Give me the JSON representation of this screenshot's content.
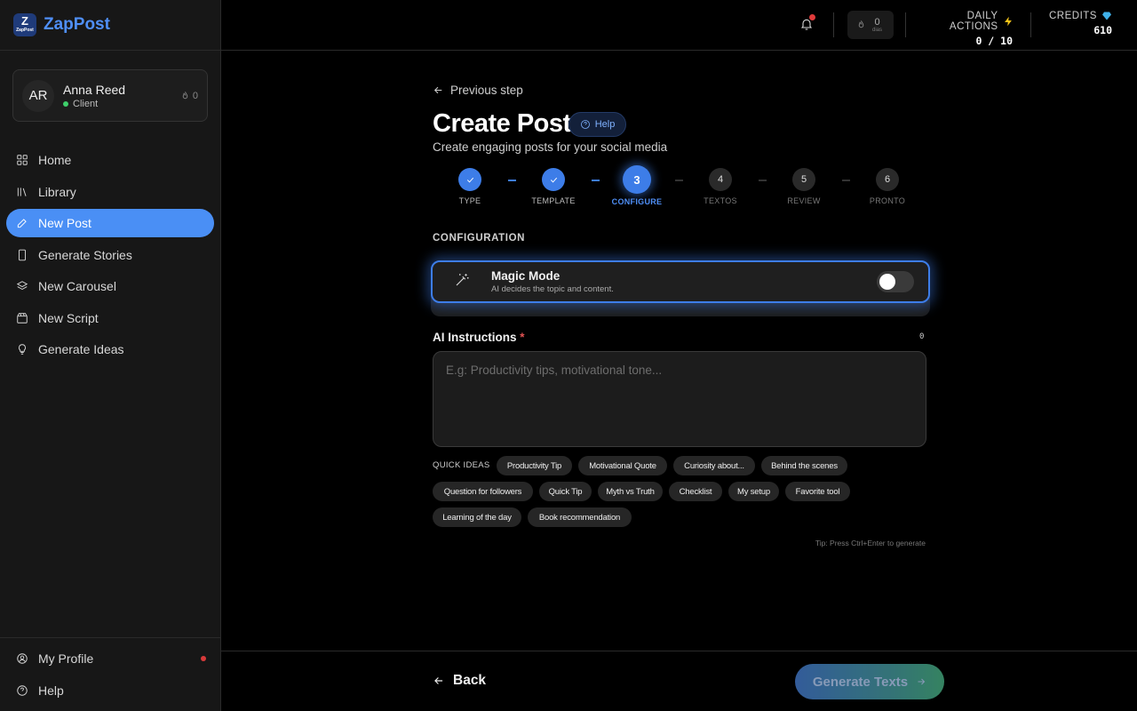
{
  "brand": {
    "logo_line1": "Z",
    "logo_line2": "ZapPost",
    "name": "ZapPost"
  },
  "user": {
    "initials": "AR",
    "name": "Anna Reed",
    "role": "Client",
    "streak": "0"
  },
  "nav": {
    "items": [
      {
        "label": "Home",
        "icon": "grid-icon"
      },
      {
        "label": "Library",
        "icon": "library-icon"
      },
      {
        "label": "New Post",
        "icon": "pen-icon",
        "active": true
      },
      {
        "label": "Generate Stories",
        "icon": "phone-icon"
      },
      {
        "label": "New Carousel",
        "icon": "layers-icon"
      },
      {
        "label": "New Script",
        "icon": "clapper-icon"
      },
      {
        "label": "Generate Ideas",
        "icon": "lightbulb-icon"
      }
    ],
    "bottom": [
      {
        "label": "My Profile",
        "icon": "user-circle-icon"
      },
      {
        "label": "Help",
        "icon": "help-circle-icon"
      }
    ]
  },
  "topbar": {
    "streak_value": "0",
    "streak_unit": "dias",
    "daily_actions_label": "DAILY ACTIONS",
    "daily_actions_value": "0 / 10",
    "credits_label": "CREDITS",
    "credits_value": "610"
  },
  "page": {
    "prev_step": "Previous step",
    "title": "Create Post",
    "help": "Help",
    "subtitle": "Create engaging posts for your social media"
  },
  "steps": [
    {
      "num": "1",
      "label": "TYPE",
      "state": "done"
    },
    {
      "num": "2",
      "label": "TEMPLATE",
      "state": "done"
    },
    {
      "num": "3",
      "label": "CONFIGURE",
      "state": "current"
    },
    {
      "num": "4",
      "label": "TEXTOS",
      "state": "upcoming"
    },
    {
      "num": "5",
      "label": "REVIEW",
      "state": "upcoming"
    },
    {
      "num": "6",
      "label": "PRONTO",
      "state": "upcoming"
    }
  ],
  "config": {
    "section_label": "CONFIGURATION",
    "magic_title": "Magic Mode",
    "magic_desc": "AI decides the topic and content.",
    "magic_enabled": false
  },
  "instructions": {
    "label": "AI Instructions",
    "required_mark": "*",
    "char_count": "0",
    "placeholder": "E.g: Productivity tips, motivational tone...",
    "value": ""
  },
  "quick_ideas": {
    "label": "QUICK IDEAS",
    "chips": [
      "Productivity Tip",
      "Motivational Quote",
      "Curiosity about...",
      "Behind the scenes",
      "Question for followers",
      "Quick Tip",
      "Myth vs Truth",
      "Checklist",
      "My setup",
      "Favorite tool",
      "Learning of the day",
      "Book recommendation"
    ]
  },
  "tip": "Tip: Press Ctrl+Enter to generate",
  "footer": {
    "back": "Back",
    "generate": "Generate Texts"
  },
  "colors": {
    "accent": "#4a8ff5",
    "background": "#000000",
    "sidebar": "#171717"
  }
}
